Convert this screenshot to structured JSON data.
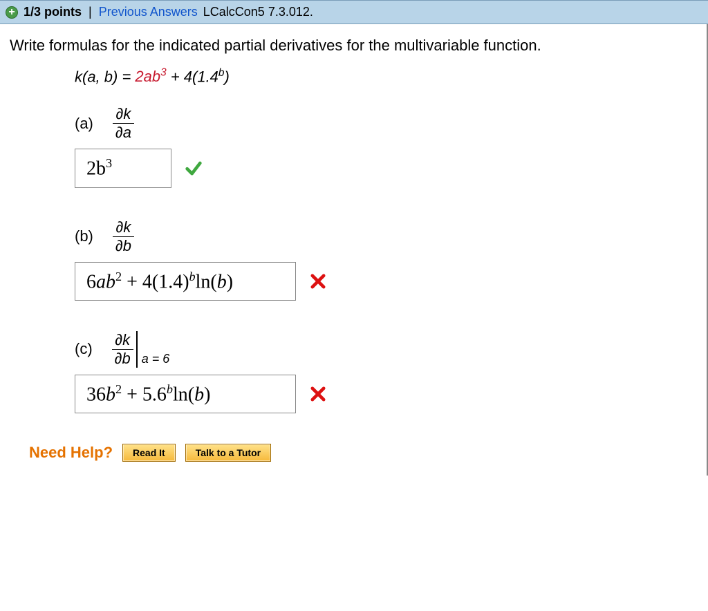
{
  "header": {
    "points": "1/3 points",
    "prev_answers": "Previous Answers",
    "code": "LCalcCon5 7.3.012."
  },
  "prompt": "Write formulas for the indicated partial derivatives for the multivariable function.",
  "function_prefix": "k(a, b) = ",
  "function_red": "2ab",
  "function_red_sup": "3",
  "function_after": " + 4(1.4",
  "function_sup_b": "b",
  "function_close": ")",
  "parts": {
    "a": {
      "label": "(a)",
      "dk": "∂k",
      "dv": "∂a",
      "answer_plain": "2b",
      "answer_sup": "3",
      "status": "correct"
    },
    "b": {
      "label": "(b)",
      "dk": "∂k",
      "dv": "∂b",
      "answer_html_segments": {
        "s1": "6",
        "s2": "ab",
        "s3": "2",
        "s4": " + 4(1.4)",
        "s5": "b",
        "s6": "ln(",
        "s7": "b",
        "s8": ")"
      },
      "status": "incorrect"
    },
    "c": {
      "label": "(c)",
      "dk": "∂k",
      "dv": "∂b",
      "eval_at": "a = 6",
      "answer_html_segments": {
        "s1": "36",
        "s2": "b",
        "s3": "2",
        "s4": " + 5.6",
        "s5": "b",
        "s6": "ln(",
        "s7": "b",
        "s8": ")"
      },
      "status": "incorrect"
    }
  },
  "help": {
    "label": "Need Help?",
    "read": "Read It",
    "tutor": "Talk to a Tutor"
  }
}
